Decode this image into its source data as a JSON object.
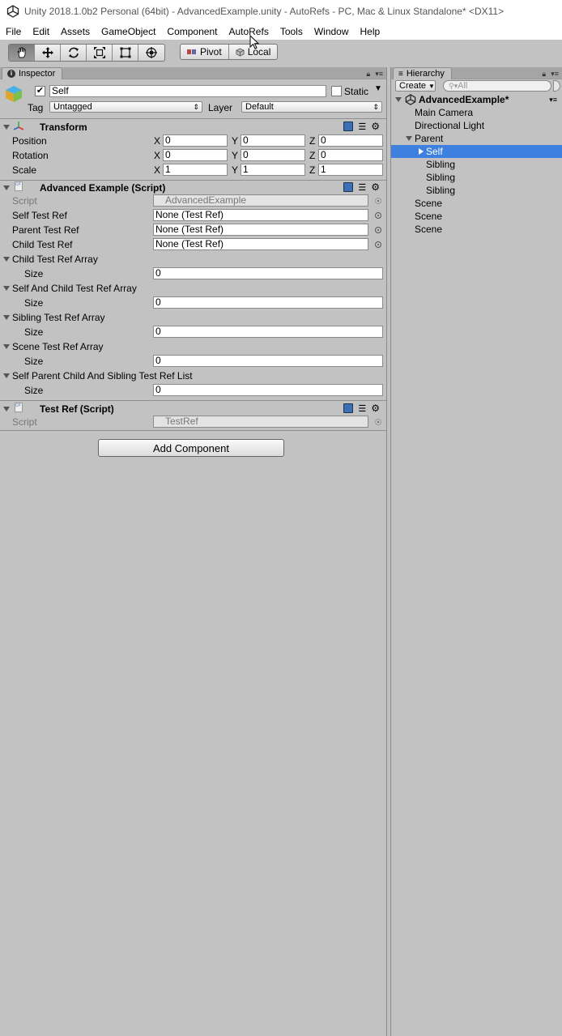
{
  "window": {
    "title": "Unity 2018.1.0b2 Personal (64bit) - AdvancedExample.unity - AutoRefs - PC, Mac & Linux Standalone* <DX11>"
  },
  "menu": [
    "File",
    "Edit",
    "Assets",
    "GameObject",
    "Component",
    "AutoRefs",
    "Tools",
    "Window",
    "Help"
  ],
  "toolbar": {
    "tools": [
      "hand-tool-icon",
      "move-tool-icon",
      "rotate-tool-icon",
      "scale-tool-icon",
      "rect-tool-icon",
      "transform-tool-icon"
    ],
    "pivot_label": "Pivot",
    "local_label": "Local"
  },
  "inspector": {
    "tab_label": "Inspector",
    "object_name": "Self",
    "static_label": "Static",
    "tag_label": "Tag",
    "tag_value": "Untagged",
    "layer_label": "Layer",
    "layer_value": "Default",
    "transform": {
      "title": "Transform",
      "position_label": "Position",
      "rotation_label": "Rotation",
      "scale_label": "Scale",
      "axis_x": "X",
      "axis_y": "Y",
      "axis_z": "Z",
      "position": [
        "0",
        "0",
        "0"
      ],
      "rotation": [
        "0",
        "0",
        "0"
      ],
      "scale": [
        "1",
        "1",
        "1"
      ]
    },
    "advanced": {
      "title": "Advanced Example (Script)",
      "script_label": "Script",
      "script_value": "AdvancedExample",
      "self_ref_label": "Self Test Ref",
      "self_ref_value": "None (Test Ref)",
      "parent_ref_label": "Parent Test Ref",
      "parent_ref_value": "None (Test Ref)",
      "child_ref_label": "Child Test Ref",
      "child_ref_value": "None (Test Ref)",
      "arrays": [
        {
          "label": "Child Test Ref Array",
          "size_label": "Size",
          "size": "0"
        },
        {
          "label": "Self And Child Test Ref Array",
          "size_label": "Size",
          "size": "0"
        },
        {
          "label": "Sibling Test Ref Array",
          "size_label": "Size",
          "size": "0"
        },
        {
          "label": "Scene Test Ref Array",
          "size_label": "Size",
          "size": "0"
        },
        {
          "label": "Self Parent Child And Sibling Test Ref List",
          "size_label": "Size",
          "size": "0"
        }
      ]
    },
    "testref": {
      "title": "Test Ref (Script)",
      "script_label": "Script",
      "script_value": "TestRef"
    },
    "add_component": "Add Component"
  },
  "hierarchy": {
    "tab_label": "Hierarchy",
    "create_label": "Create",
    "search_placeholder": "All",
    "scene": "AdvancedExample*",
    "items": [
      "Main Camera",
      "Directional Light",
      "Parent",
      "Self",
      "Sibling",
      "Sibling",
      "Sibling",
      "Scene",
      "Scene",
      "Scene"
    ]
  }
}
